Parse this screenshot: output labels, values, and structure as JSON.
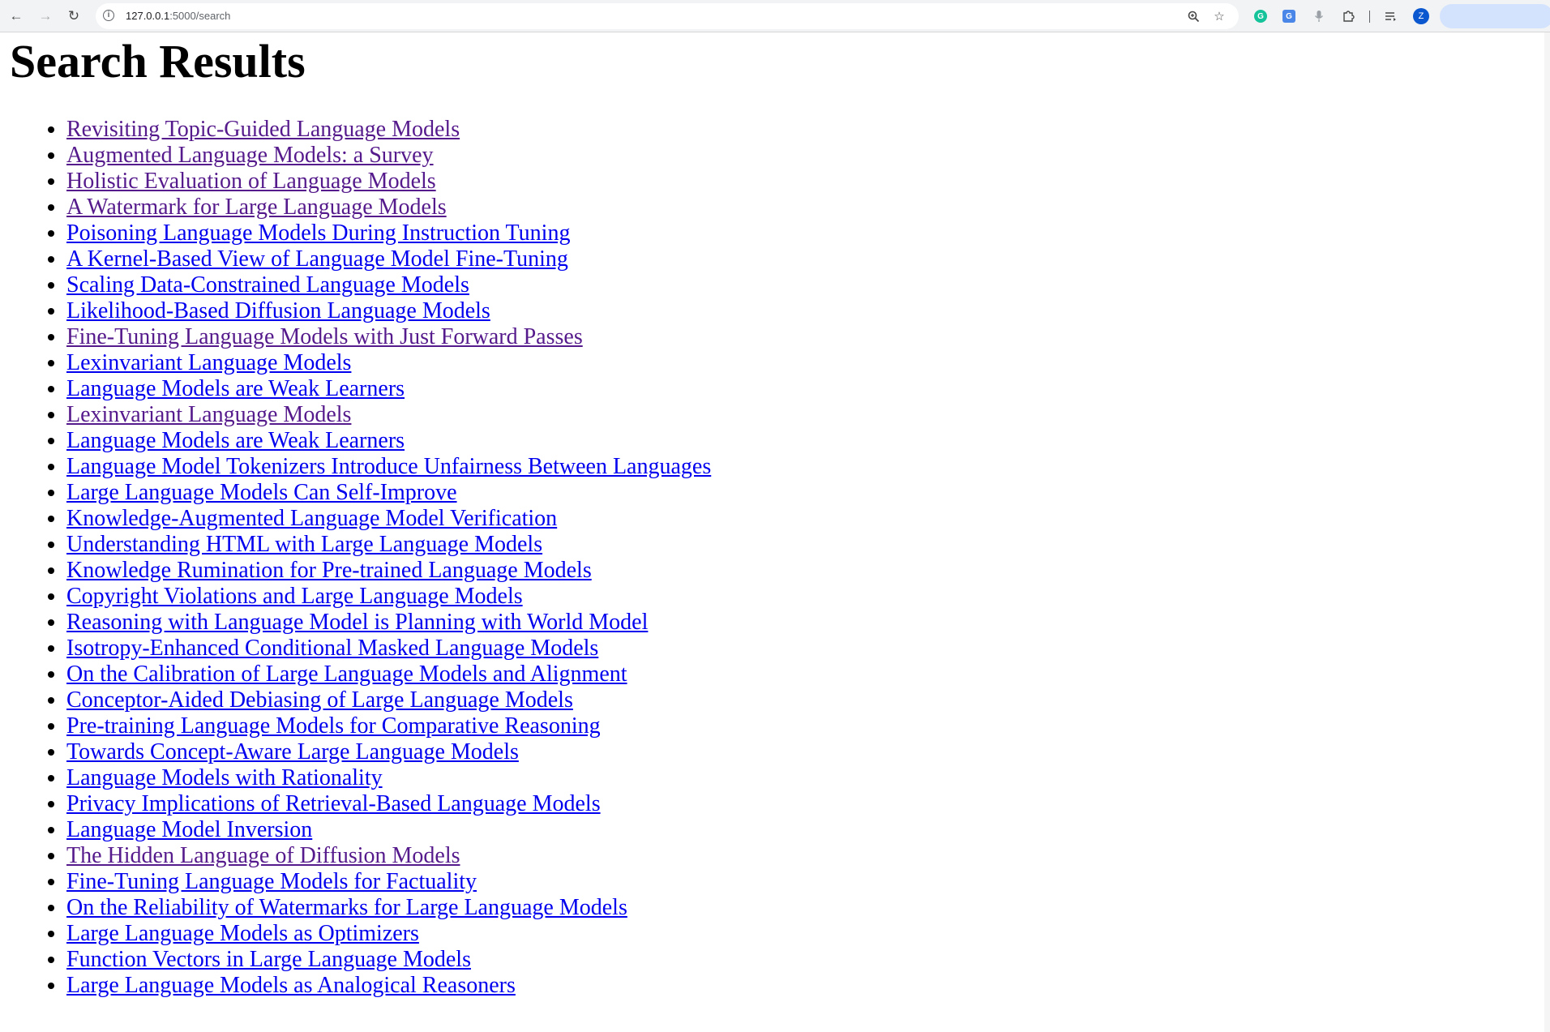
{
  "browser": {
    "url_host": "127.0.0.1",
    "url_path": ":5000/search",
    "avatar_letter": "Z",
    "icons": {
      "back": "arrow-left-icon",
      "forward": "arrow-right-icon",
      "reload": "reload-icon",
      "site_info": "info-icon",
      "zoom": "zoom-icon",
      "bookmark": "star-icon",
      "grammarly": "grammarly-icon",
      "translate": "translate-icon",
      "voice": "microphone-icon",
      "extensions": "puzzle-icon",
      "tab_search": "tab-list-icon"
    }
  },
  "page": {
    "title": "Search Results",
    "colors": {
      "link": "#0000ee",
      "visited_link": "#551a8b"
    },
    "results": [
      {
        "title": "Revisiting Topic-Guided Language Models",
        "visited": true
      },
      {
        "title": "Augmented Language Models: a Survey",
        "visited": true
      },
      {
        "title": "Holistic Evaluation of Language Models",
        "visited": true
      },
      {
        "title": "A Watermark for Large Language Models",
        "visited": true
      },
      {
        "title": "Poisoning Language Models During Instruction Tuning",
        "visited": false
      },
      {
        "title": "A Kernel-Based View of Language Model Fine-Tuning",
        "visited": false
      },
      {
        "title": "Scaling Data-Constrained Language Models",
        "visited": false
      },
      {
        "title": "Likelihood-Based Diffusion Language Models",
        "visited": false
      },
      {
        "title": "Fine-Tuning Language Models with Just Forward Passes",
        "visited": true
      },
      {
        "title": "Lexinvariant Language Models",
        "visited": false
      },
      {
        "title": "Language Models are Weak Learners",
        "visited": false
      },
      {
        "title": "Lexinvariant Language Models",
        "visited": true
      },
      {
        "title": "Language Models are Weak Learners",
        "visited": false
      },
      {
        "title": "Language Model Tokenizers Introduce Unfairness Between Languages",
        "visited": false
      },
      {
        "title": "Large Language Models Can Self-Improve",
        "visited": false
      },
      {
        "title": "Knowledge-Augmented Language Model Verification",
        "visited": false
      },
      {
        "title": "Understanding HTML with Large Language Models",
        "visited": false
      },
      {
        "title": "Knowledge Rumination for Pre-trained Language Models",
        "visited": false
      },
      {
        "title": "Copyright Violations and Large Language Models",
        "visited": false
      },
      {
        "title": "Reasoning with Language Model is Planning with World Model",
        "visited": false
      },
      {
        "title": "Isotropy-Enhanced Conditional Masked Language Models",
        "visited": false
      },
      {
        "title": "On the Calibration of Large Language Models and Alignment",
        "visited": false
      },
      {
        "title": "Conceptor-Aided Debiasing of Large Language Models",
        "visited": false
      },
      {
        "title": "Pre-training Language Models for Comparative Reasoning",
        "visited": false
      },
      {
        "title": "Towards Concept-Aware Large Language Models",
        "visited": false
      },
      {
        "title": "Language Models with Rationality",
        "visited": false
      },
      {
        "title": "Privacy Implications of Retrieval-Based Language Models",
        "visited": false
      },
      {
        "title": "Language Model Inversion",
        "visited": false
      },
      {
        "title": "The Hidden Language of Diffusion Models",
        "visited": true
      },
      {
        "title": "Fine-Tuning Language Models for Factuality",
        "visited": false
      },
      {
        "title": "On the Reliability of Watermarks for Large Language Models",
        "visited": false
      },
      {
        "title": "Large Language Models as Optimizers",
        "visited": false
      },
      {
        "title": "Function Vectors in Large Language Models",
        "visited": false
      },
      {
        "title": "Large Language Models as Analogical Reasoners",
        "visited": false
      }
    ]
  }
}
